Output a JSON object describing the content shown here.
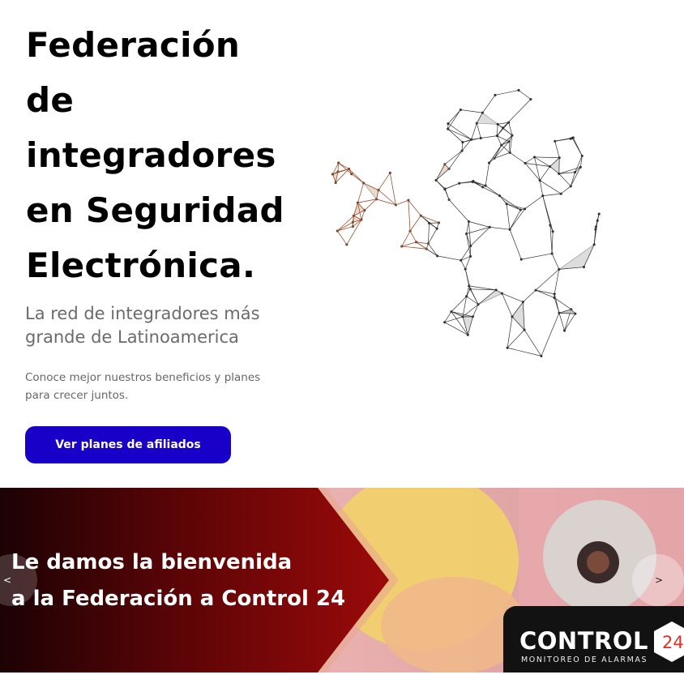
{
  "hero": {
    "title": "Federación de integradores en Seguridad Electrónica.",
    "subtitle": "La red de integradores más grande de Latinoamerica",
    "text": "Conoce mejor nuestros beneficios y planes para crecer juntos.",
    "cta_label": "Ver planes de afiliados",
    "illustration_icon": "polygon-lion-icon"
  },
  "banner": {
    "title_line1": "Le damos la bienvenida",
    "title_line2": "a la Federación a Control 24",
    "prev_label": "<",
    "next_label": ">",
    "logo": {
      "word": "CONTROL",
      "number": "24",
      "tagline": "MONITOREO DE ALARMAS"
    }
  },
  "colors": {
    "cta": "#1800c8",
    "banner_red": "#8b0606",
    "logo_accent": "#d4332a"
  }
}
